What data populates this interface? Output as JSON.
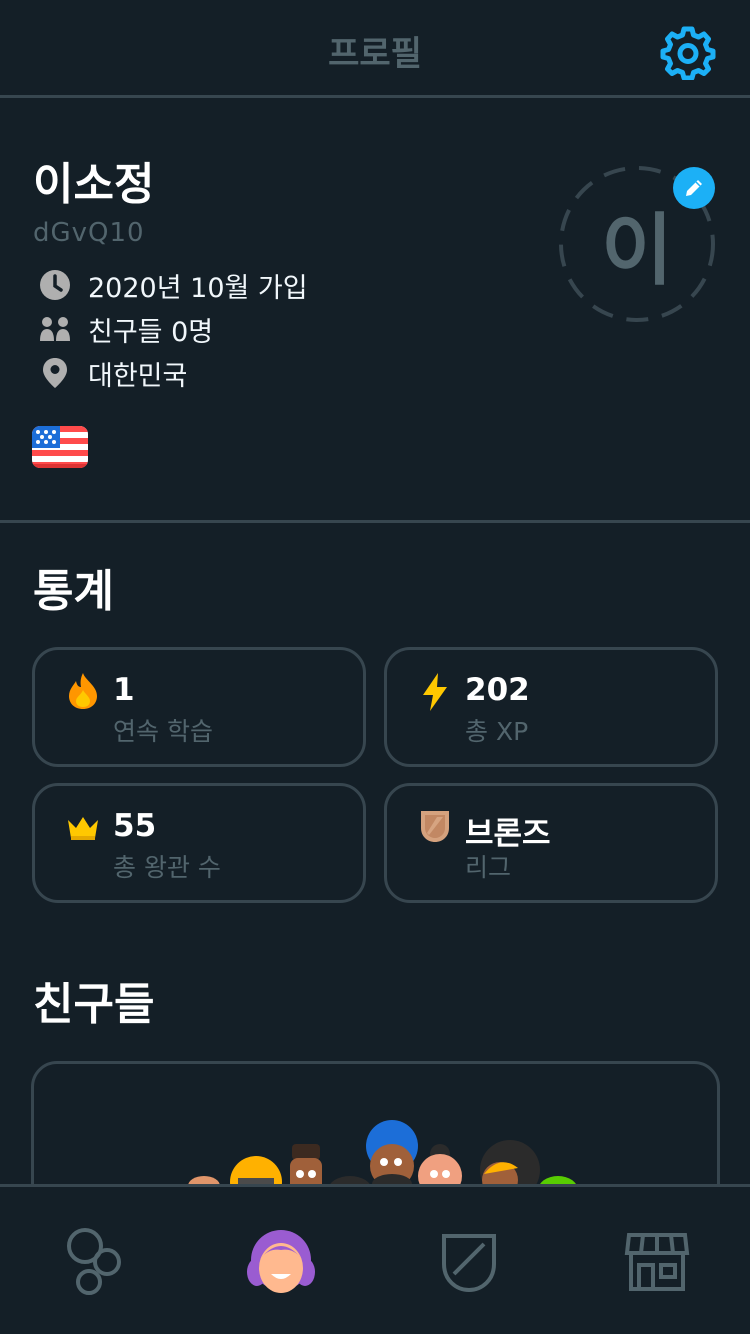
{
  "header": {
    "title": "프로필",
    "settings_icon": "gear-icon"
  },
  "profile": {
    "name": "이소정",
    "username": "dGvQ10",
    "avatar_initial": "이",
    "joined": "2020년 10월 가입",
    "friends": "친구들 0명",
    "country": "대한민국",
    "course_flag": "us-flag-icon"
  },
  "stats": {
    "title": "통계",
    "cards": [
      {
        "value": "1",
        "label": "연속 학습",
        "icon": "flame-icon"
      },
      {
        "value": "202",
        "label": "총 XP",
        "icon": "lightning-icon"
      },
      {
        "value": "55",
        "label": "총 왕관 수",
        "icon": "crown-icon"
      },
      {
        "value": "브론즈",
        "label": "리그",
        "icon": "bronze-shield-icon"
      }
    ]
  },
  "friends": {
    "title": "친구들"
  },
  "nav": {
    "items": [
      "learn-icon",
      "profile-icon",
      "leaderboard-icon",
      "shop-icon"
    ]
  },
  "colors": {
    "background": "#141f27",
    "border": "#37464f",
    "muted_text": "#52656d",
    "accent_blue": "#1cb0f6",
    "flame": "#ff9600",
    "xp": "#ffc800",
    "crown": "#ffc800",
    "bronze": "#d5a27e"
  }
}
